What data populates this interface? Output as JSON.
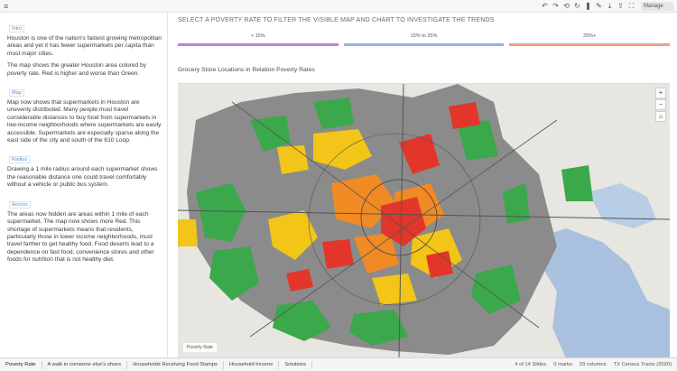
{
  "toolbar": {
    "user_label": "Manage"
  },
  "story": {
    "sections": [
      {
        "tag": "Intro",
        "text": "Houston is one of the nation's fastest growing metropolitan areas and yet it has fewer supermarkets per capita than most major cities."
      },
      {
        "tag": "",
        "text": "The map shows the greater Houston area colored by poverty rate. Red is higher and worse than Green."
      },
      {
        "tag": "Map",
        "text": "Map now shows that supermarkets in Houston are unevenly distributed. Many people must travel considerable distances to buy food from supermarkets in low-income neighborhoods where supermarkets are easily accessible. Supermarkets are especially sparse along the east side of the city and south of the 610 Loop."
      },
      {
        "tag": "Radius",
        "text": "Drawing a 1 mile radius around each supermarket shows the reasonable distance one could travel comfortably without a vehicle or public bus system."
      },
      {
        "tag": "Access",
        "text": "The areas now hidden are areas within 1 mile of each supermarket. The map now shows more Red. This shortage of supermarkets means that residents, particularly those in lower income neighborhoods, must travel farther to get healthy food. Food deserts lead to a dependence on fast food, convenience stores and other foods for nutrition that is not healthy diet."
      }
    ]
  },
  "main": {
    "prompt": "SELECT A POVERTY RATE TO FILTER THE VISIBLE MAP AND CHART TO INVESTIGATE THE TRENDS",
    "filters": [
      {
        "label": "< 15%",
        "color": "#b583e0"
      },
      {
        "label": "15% to 25%",
        "color": "#96aef0"
      },
      {
        "label": "25%+",
        "color": "#f2a083"
      }
    ],
    "map_title": "Grocery Store Locations in Relation Poverty Rates",
    "legend": "Poverty Rate",
    "colors": {
      "base": "#8b8b8b",
      "green": "#3aa84b",
      "yellow": "#f2c518",
      "orange": "#f08a23",
      "red": "#e2362b",
      "water": "#a9c1de",
      "land": "#e8e6e1"
    }
  },
  "tabs": [
    "Poverty Rate",
    "A walk in someone else's shoes",
    "Households Receiving Food Stamps",
    "Household Income",
    "Solutions"
  ],
  "status": {
    "pager": "4 of 14 Slides",
    "marks": "0 marks",
    "rows": "29 columns",
    "source": "TX Census Tracts (2020)"
  }
}
